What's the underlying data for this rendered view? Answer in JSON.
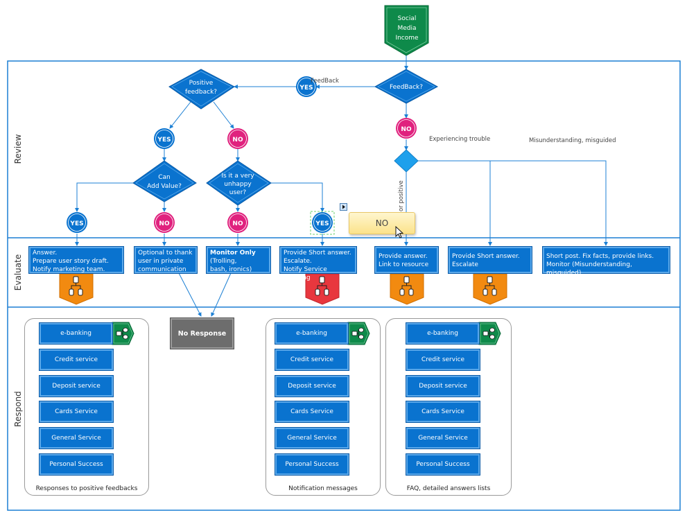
{
  "lanes": [
    {
      "label": "Review"
    },
    {
      "label": "Evaluate"
    },
    {
      "label": "Respond"
    }
  ],
  "start": {
    "label_lines": [
      "Social",
      "Media",
      "Income"
    ],
    "color": "#0e8a4a"
  },
  "decisions": {
    "feedback": {
      "label_lines": [
        "FeedBack?"
      ]
    },
    "positive": {
      "label_lines": [
        "Positive",
        "feedback?"
      ]
    },
    "add_value": {
      "label_lines": [
        "Can",
        "Add Value?"
      ]
    },
    "unhappy": {
      "label_lines": [
        "Is it a very",
        "unhappy",
        "user?"
      ]
    }
  },
  "connectors": {
    "yes_feedback": "YES",
    "no_feedback": "NO",
    "yes_positive": "YES",
    "no_positive": "NO",
    "yes_add_value": "YES",
    "no_add_value": "NO",
    "no_unhappy": "NO",
    "yes_unhappy": "YES"
  },
  "edge_labels": {
    "feedback": "FeedBack",
    "experiencing_trouble": "Experiencing trouble",
    "misunderstanding": "Misunderstanding, misguided",
    "or_positive": "or positive"
  },
  "tooltip": {
    "label": "NO"
  },
  "evaluate_boxes": [
    {
      "text": "Answer.\nPrepare user story draft.\nNotify marketing team.",
      "badge": "orange"
    },
    {
      "text": "Optional to thank\nuser in private\ncommunication",
      "badge": null
    },
    {
      "text_bold": "Monitor Only",
      "text": "(Trolling,\nbash, ironics)",
      "badge": null
    },
    {
      "text": "Provide Short answer.\nEscalate.\nNotify Service Planning",
      "badge": "red"
    },
    {
      "text": "Provide answer.\nLink to resource",
      "badge": "orange"
    },
    {
      "text": "Provide Short answer.\nEscalate",
      "badge": "orange"
    },
    {
      "text": "Short post. Fix facts, provide links.\nMonitor (Misunderstanding, misguided)",
      "badge": null
    }
  ],
  "no_response": {
    "label": "No Response"
  },
  "respond_groups": [
    {
      "caption": "Responses to positive feedbacks",
      "services": [
        "e-banking",
        "Credit service",
        "Deposit service",
        "Cards Service",
        "General Service",
        "Personal Success"
      ]
    },
    {
      "caption": "Notification messages",
      "services": [
        "e-banking",
        "Credit service",
        "Deposit service",
        "Cards Service",
        "General Service",
        "Personal Success"
      ]
    },
    {
      "caption": "FAQ, detailed answers lists",
      "services": [
        "e-banking",
        "Credit service",
        "Deposit service",
        "Cards Service",
        "General Service",
        "Personal Success"
      ]
    }
  ],
  "colors": {
    "primary_blue": "#0a73cf",
    "line_blue": "#1b7fd4",
    "magenta": "#e0227e",
    "green": "#0e8a4a",
    "orange": "#f28a10",
    "red": "#e8373e",
    "gray": "#6d6d6d",
    "decision_light": "#1ea0ec"
  }
}
